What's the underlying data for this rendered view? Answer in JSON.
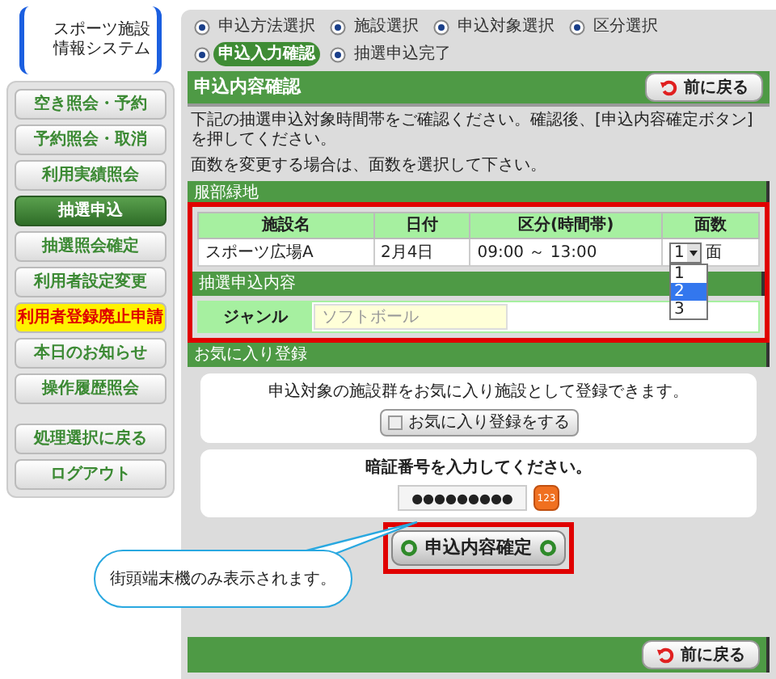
{
  "logo": {
    "lines": [
      "スポーツ施設",
      "情報システム"
    ]
  },
  "sidebar": {
    "groups": [
      [
        {
          "label": "空き照会・予約",
          "selected": false,
          "kind": "normal"
        },
        {
          "label": "予約照会・取消",
          "selected": false,
          "kind": "normal"
        },
        {
          "label": "利用実績照会",
          "selected": false,
          "kind": "normal"
        },
        {
          "label": "抽選申込",
          "selected": true,
          "kind": "normal"
        },
        {
          "label": "抽選照会確定",
          "selected": false,
          "kind": "normal"
        },
        {
          "label": "利用者設定変更",
          "selected": false,
          "kind": "normal"
        },
        {
          "label": "利用者登録廃止申請",
          "selected": false,
          "kind": "warning"
        },
        {
          "label": "本日のお知らせ",
          "selected": false,
          "kind": "normal"
        },
        {
          "label": "操作履歴照会",
          "selected": false,
          "kind": "normal"
        }
      ],
      [
        {
          "label": "処理選択に戻る",
          "selected": false,
          "kind": "normal"
        },
        {
          "label": "ログアウト",
          "selected": false,
          "kind": "normal"
        }
      ]
    ]
  },
  "steps": [
    {
      "label": "申込方法選択",
      "selected": false
    },
    {
      "label": "施設選択",
      "selected": false
    },
    {
      "label": "申込対象選択",
      "selected": false
    },
    {
      "label": "区分選択",
      "selected": false
    },
    {
      "label": "申込入力確認",
      "selected": true
    },
    {
      "label": "抽選申込完了",
      "selected": false
    }
  ],
  "header": {
    "title": "申込内容確認",
    "back_button": "前に戻る"
  },
  "instructions": [
    "下記の抽選申込対象時間帯をご確認ください。確認後、[申込内容確定ボタン]を押してください。",
    "面数を変更する場合は、面数を選択して下さい。"
  ],
  "facility_group": {
    "title": "服部緑地",
    "columns": [
      "施設名",
      "日付",
      "区分(時間帯)",
      "面数"
    ],
    "rows": [
      {
        "facility": "スポーツ広場A",
        "date": "2月4日",
        "slot": "09:00 ～ 13:00",
        "count": "1",
        "unit": "面",
        "options": [
          {
            "label": "1",
            "selected": false
          },
          {
            "label": "2",
            "selected": true
          },
          {
            "label": "3",
            "selected": false
          }
        ]
      }
    ]
  },
  "lottery_details": {
    "title": "抽選申込内容",
    "label": "ジャンル",
    "value": "ソフトボール"
  },
  "favorites": {
    "title": "お気に入り登録",
    "text": "申込対象の施設群をお気に入り施設として登録できます。",
    "button": "お気に入り登録をする",
    "checked": false
  },
  "pin": {
    "prompt": "暗証番号を入力してください。",
    "value": "●●●●●●●●●",
    "keypad_button": "123"
  },
  "confirm_button": "申込内容確定",
  "callout": "街頭端末機のみ表示されます。",
  "footer": {
    "back_button": "前に戻る"
  }
}
